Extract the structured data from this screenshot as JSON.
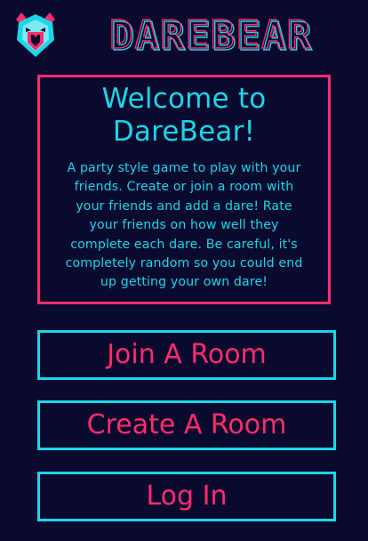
{
  "header": {
    "brand_text": "DAREBEAR",
    "logo_icon": "bear-head-icon"
  },
  "welcome": {
    "title_line1": "Welcome to",
    "title_line2": "DareBear!",
    "body_lines": [
      "A party style game to play with your",
      "friends. Create or join a room with",
      "your friends and add a dare! Rate",
      "your friends on how well they",
      "complete each dare. Be careful, it's",
      "completely random so you could end",
      "up getting your own dare!"
    ]
  },
  "menu": {
    "join_label": "Join A Room",
    "create_label": "Create A Room",
    "login_label": "Log In"
  },
  "colors": {
    "background": "#0a0a2e",
    "accent_pink": "#ff2a6d",
    "accent_cyan": "#18d7e8"
  }
}
